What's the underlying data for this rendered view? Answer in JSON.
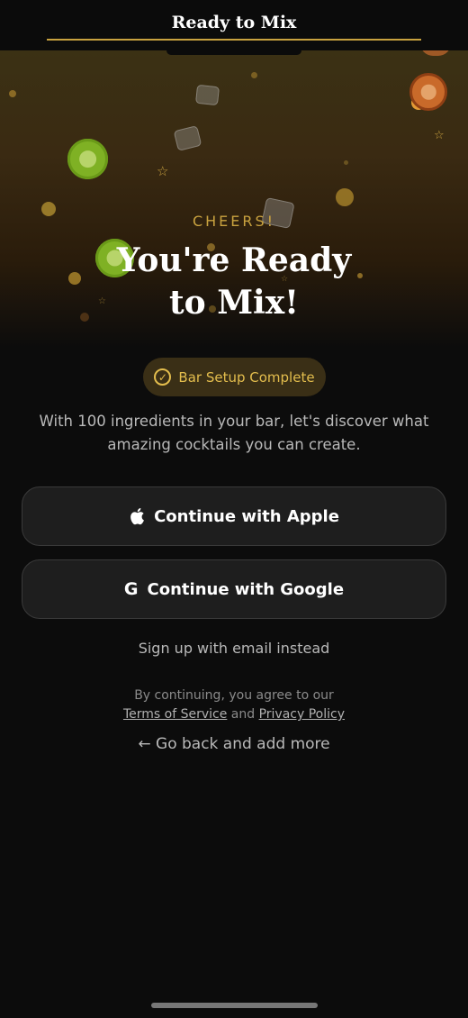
{
  "header": {
    "title": "Ready to Mix"
  },
  "hero": {
    "eyebrow": "CHEERS!",
    "headline_line1": "You're Ready",
    "headline_line2": "to Mix!"
  },
  "badge": {
    "icon": "check-circle-icon",
    "label": "Bar Setup Complete"
  },
  "description": "With 100 ingredients in your bar, let's discover what amazing cocktails you can create.",
  "auth": {
    "apple_label": "Continue with Apple",
    "google_label": "Continue with Google",
    "email_label": "Sign up with email instead"
  },
  "legal": {
    "prefix": "By continuing, you agree to our",
    "terms": "Terms of Service",
    "and": "and",
    "privacy": "Privacy Policy"
  },
  "back": {
    "arrow": "←",
    "label": "Go back and add more"
  },
  "colors": {
    "accent": "#c9a23f",
    "background": "#0c0c0c",
    "button_bg": "#1e1e1e"
  }
}
